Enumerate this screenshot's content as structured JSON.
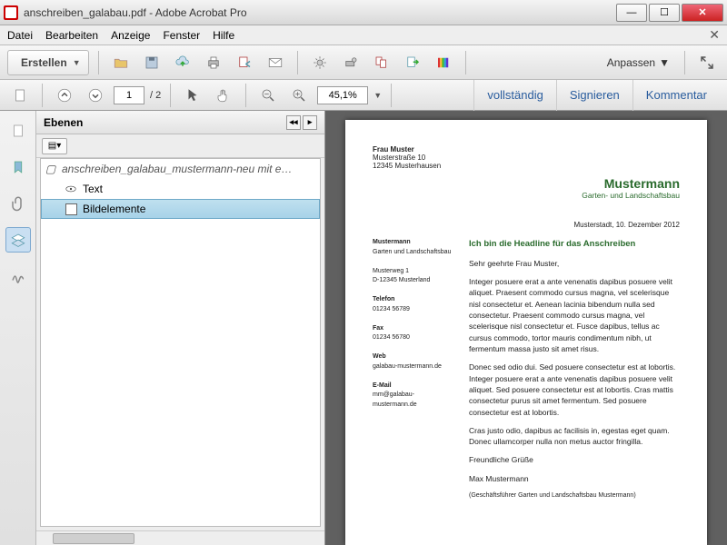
{
  "window": {
    "title": "anschreiben_galabau.pdf - Adobe Acrobat Pro"
  },
  "menu": {
    "datei": "Datei",
    "bearbeiten": "Bearbeiten",
    "anzeige": "Anzeige",
    "fenster": "Fenster",
    "hilfe": "Hilfe"
  },
  "toolbar": {
    "create_label": "Erstellen",
    "anpassen_label": "Anpassen"
  },
  "nav": {
    "page_current": "1",
    "page_total": "/  2",
    "zoom": "45,1%",
    "link_full": "vollständig",
    "link_sign": "Signieren",
    "link_comment": "Kommentar"
  },
  "side": {
    "title": "Ebenen",
    "root": "anschreiben_galabau_mustermann-neu mit e…",
    "layer_text": "Text",
    "layer_images": "Bildelemente"
  },
  "doc": {
    "to_name": "Frau Muster",
    "to_street": "Musterstraße 10",
    "to_city": "12345 Musterhausen",
    "brand_name": "Mustermann",
    "brand_sub": "Garten- und Landschaftsbau",
    "date": "Musterstadt, 10. Dezember 2012",
    "sender_name": "Mustermann",
    "sender_sub": "Garten und Landschaftsbau",
    "sender_addr1": "Musterweg 1",
    "sender_addr2": "D-12345 Musterland",
    "tel_label": "Telefon",
    "tel": "01234 56789",
    "fax_label": "Fax",
    "fax": "01234 56780",
    "web_label": "Web",
    "web": "galabau-mustermann.de",
    "mail_label": "E-Mail",
    "mail": "mm@galabau-mustermann.de",
    "headline": "Ich bin die Headline für das Anschreiben",
    "salutation": "Sehr geehrte Frau Muster,",
    "p1": "Integer posuere erat a ante venenatis dapibus posuere velit aliquet. Praesent commodo cursus magna, vel scelerisque nisl consectetur et. Aenean lacinia bibendum nulla sed consectetur. Praesent commodo cursus magna, vel scelerisque nisl consectetur et. Fusce dapibus, tellus ac cursus commodo, tortor mauris condimentum nibh, ut fermentum massa justo sit amet risus.",
    "p2": "Donec sed odio dui. Sed posuere consectetur est at lobortis. Integer posuere erat a ante venenatis dapibus posuere velit aliquet. Sed posuere consectetur est at lobortis. Cras mattis consectetur purus sit amet fermentum. Sed posuere consectetur est at lobortis.",
    "p3": "Cras justo odio, dapibus ac facilisis in, egestas eget quam. Donec ullamcorper nulla non metus auctor fringilla.",
    "closing": "Freundliche Grüße",
    "sig_name": "Max Mustermann",
    "sig_sub": "(Geschäftsführer Garten und Landschaftsbau Mustermann)"
  }
}
